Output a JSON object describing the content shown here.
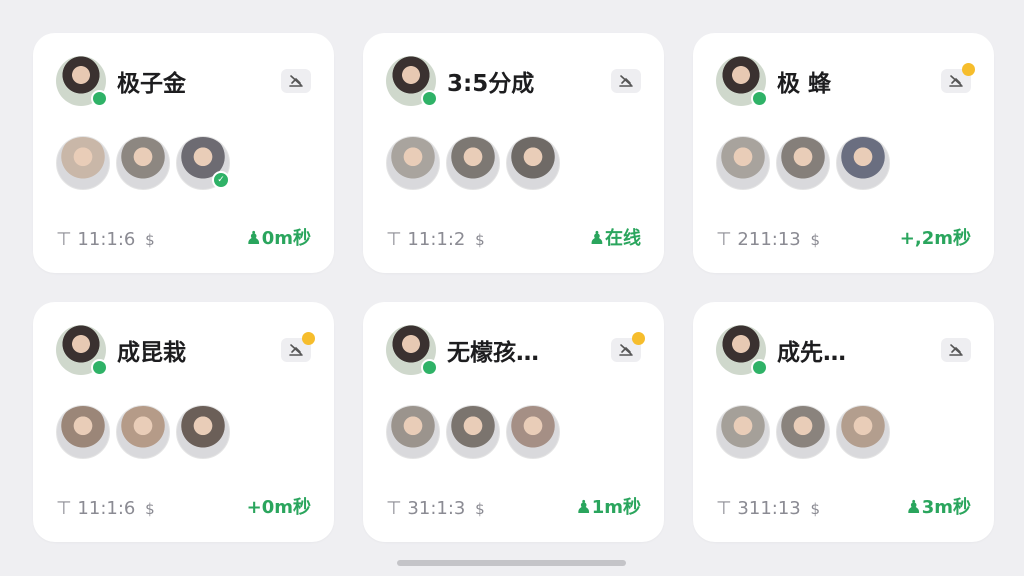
{
  "colors": {
    "accent": "#2aa55d",
    "notification": "#f6bd2c",
    "background": "#efeff2"
  },
  "cards": [
    {
      "title": "极子金",
      "meta": "11:1:6",
      "status": "0m秒",
      "status_icon": "person-icon",
      "has_notification": false,
      "members": [
        {
          "icon": "avatar",
          "tone": "#c9b7a8",
          "checked": false
        },
        {
          "icon": "avatar",
          "tone": "#8d8781",
          "checked": false
        },
        {
          "icon": "avatar",
          "tone": "#6d6b72",
          "checked": true
        }
      ]
    },
    {
      "title": "3:5分成",
      "meta": "11:1:2",
      "status": "在线",
      "status_icon": "person-icon",
      "has_notification": false,
      "members": [
        {
          "icon": "avatar",
          "tone": "#a9a49e",
          "checked": false
        },
        {
          "icon": "avatar",
          "tone": "#7d7873",
          "checked": false
        },
        {
          "icon": "avatar",
          "tone": "#6f6a66",
          "checked": false
        }
      ]
    },
    {
      "title": "极 蜂",
      "meta": "211:13",
      "status": "+,2m秒",
      "status_icon": "",
      "has_notification": true,
      "members": [
        {
          "icon": "avatar",
          "tone": "#a8a39d",
          "checked": false
        },
        {
          "icon": "avatar",
          "tone": "#857f7a",
          "checked": false
        },
        {
          "icon": "avatar",
          "tone": "#6a6e80",
          "checked": false
        }
      ]
    },
    {
      "title": "成昆栽",
      "meta": "11:1:6",
      "status": "+0m秒",
      "status_icon": "",
      "has_notification": true,
      "members": [
        {
          "icon": "avatar",
          "tone": "#9b8678",
          "checked": false
        },
        {
          "icon": "avatar",
          "tone": "#b59b88",
          "checked": false
        },
        {
          "icon": "avatar",
          "tone": "#6b5f58",
          "checked": false
        }
      ]
    },
    {
      "title": "无檬孩…",
      "meta": "31:1:3",
      "status": "1m秒",
      "status_icon": "person-icon",
      "has_notification": true,
      "members": [
        {
          "icon": "avatar",
          "tone": "#9b948d",
          "checked": false
        },
        {
          "icon": "avatar",
          "tone": "#7b746e",
          "checked": false
        },
        {
          "icon": "avatar",
          "tone": "#a58f85",
          "checked": false
        }
      ]
    },
    {
      "title": "成先…",
      "meta": "311:13",
      "status": "3m秒",
      "status_icon": "person-icon",
      "has_notification": false,
      "members": [
        {
          "icon": "avatar",
          "tone": "#a5a099",
          "checked": false
        },
        {
          "icon": "avatar",
          "tone": "#8a837d",
          "checked": false
        },
        {
          "icon": "avatar",
          "tone": "#b39e8e",
          "checked": false
        }
      ]
    }
  ]
}
